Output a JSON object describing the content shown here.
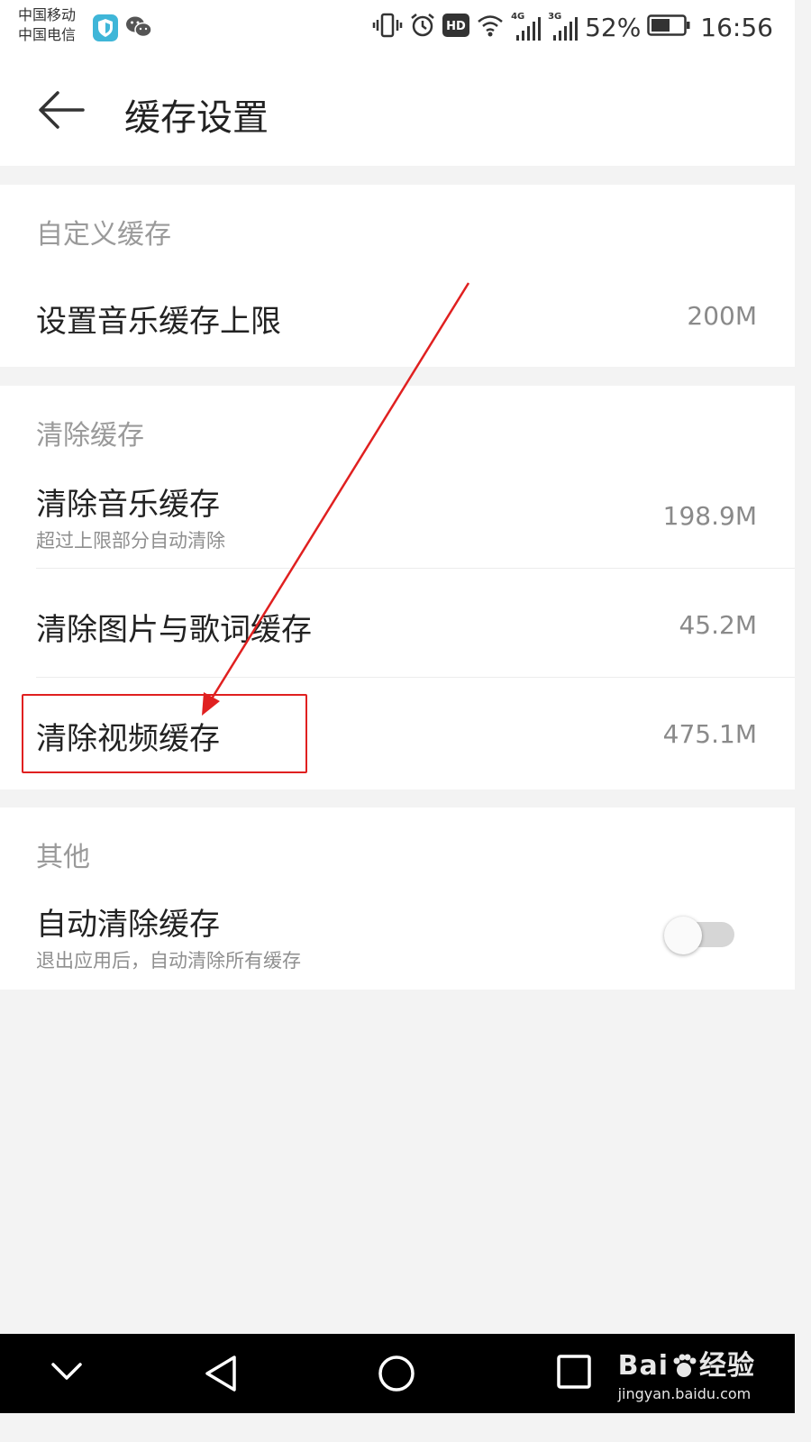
{
  "status_bar": {
    "carrier_1": "中国移动",
    "carrier_2": "中国电信",
    "network_a": "4G",
    "network_b": "3G",
    "battery": "52%",
    "time": "16:56",
    "hd_badge": "HD",
    "icons": [
      "shield-app-icon",
      "wechat-icon",
      "vibrate-icon",
      "alarm-icon",
      "hd-icon",
      "wifi-icon",
      "signal-icon",
      "battery-icon"
    ]
  },
  "header": {
    "title": "缓存设置",
    "back_icon": "arrow-left-icon"
  },
  "sections": {
    "custom": {
      "label": "自定义缓存",
      "music_limit": {
        "title": "设置音乐缓存上限",
        "value": "200M"
      }
    },
    "clear": {
      "label": "清除缓存",
      "music": {
        "title": "清除音乐缓存",
        "subtitle": "超过上限部分自动清除",
        "value": "198.9M"
      },
      "images_lyrics": {
        "title": "清除图片与歌词缓存",
        "value": "45.2M"
      },
      "video": {
        "title": "清除视频缓存",
        "value": "475.1M"
      }
    },
    "other": {
      "label": "其他",
      "auto_clear": {
        "title": "自动清除缓存",
        "subtitle": "退出应用后，自动清除所有缓存",
        "enabled": false
      }
    }
  },
  "watermark": {
    "brand": "Bai",
    "brand_tail": "经验",
    "url": "jingyan.baidu.com"
  },
  "colors": {
    "annotation_red": "#e02020",
    "background": "#f3f3f3"
  }
}
